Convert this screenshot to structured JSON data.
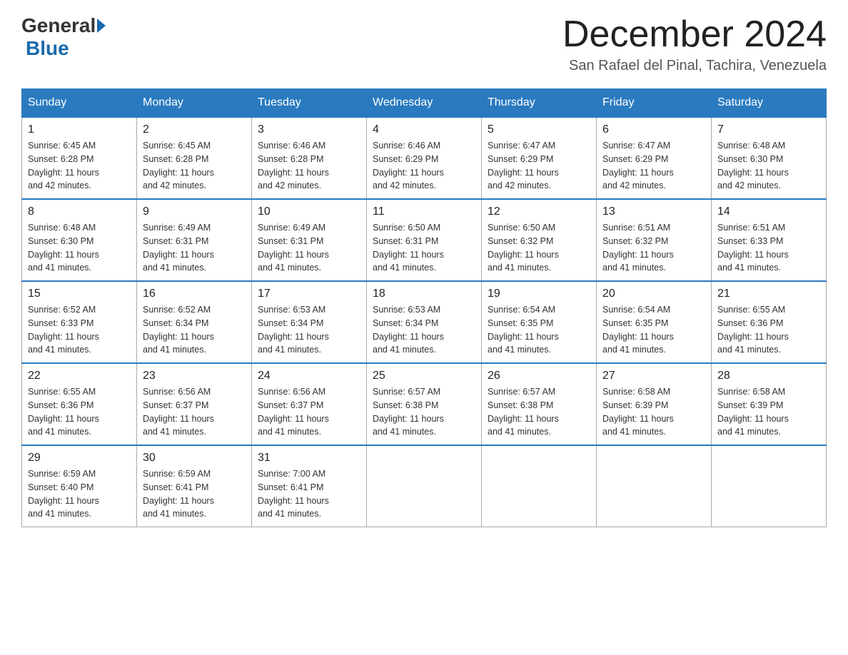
{
  "header": {
    "logo_general": "General",
    "logo_blue": "Blue",
    "month_title": "December 2024",
    "location": "San Rafael del Pinal, Tachira, Venezuela"
  },
  "days_of_week": [
    "Sunday",
    "Monday",
    "Tuesday",
    "Wednesday",
    "Thursday",
    "Friday",
    "Saturday"
  ],
  "weeks": [
    [
      {
        "day": "1",
        "sunrise": "6:45 AM",
        "sunset": "6:28 PM",
        "daylight": "11 hours and 42 minutes."
      },
      {
        "day": "2",
        "sunrise": "6:45 AM",
        "sunset": "6:28 PM",
        "daylight": "11 hours and 42 minutes."
      },
      {
        "day": "3",
        "sunrise": "6:46 AM",
        "sunset": "6:28 PM",
        "daylight": "11 hours and 42 minutes."
      },
      {
        "day": "4",
        "sunrise": "6:46 AM",
        "sunset": "6:29 PM",
        "daylight": "11 hours and 42 minutes."
      },
      {
        "day": "5",
        "sunrise": "6:47 AM",
        "sunset": "6:29 PM",
        "daylight": "11 hours and 42 minutes."
      },
      {
        "day": "6",
        "sunrise": "6:47 AM",
        "sunset": "6:29 PM",
        "daylight": "11 hours and 42 minutes."
      },
      {
        "day": "7",
        "sunrise": "6:48 AM",
        "sunset": "6:30 PM",
        "daylight": "11 hours and 42 minutes."
      }
    ],
    [
      {
        "day": "8",
        "sunrise": "6:48 AM",
        "sunset": "6:30 PM",
        "daylight": "11 hours and 41 minutes."
      },
      {
        "day": "9",
        "sunrise": "6:49 AM",
        "sunset": "6:31 PM",
        "daylight": "11 hours and 41 minutes."
      },
      {
        "day": "10",
        "sunrise": "6:49 AM",
        "sunset": "6:31 PM",
        "daylight": "11 hours and 41 minutes."
      },
      {
        "day": "11",
        "sunrise": "6:50 AM",
        "sunset": "6:31 PM",
        "daylight": "11 hours and 41 minutes."
      },
      {
        "day": "12",
        "sunrise": "6:50 AM",
        "sunset": "6:32 PM",
        "daylight": "11 hours and 41 minutes."
      },
      {
        "day": "13",
        "sunrise": "6:51 AM",
        "sunset": "6:32 PM",
        "daylight": "11 hours and 41 minutes."
      },
      {
        "day": "14",
        "sunrise": "6:51 AM",
        "sunset": "6:33 PM",
        "daylight": "11 hours and 41 minutes."
      }
    ],
    [
      {
        "day": "15",
        "sunrise": "6:52 AM",
        "sunset": "6:33 PM",
        "daylight": "11 hours and 41 minutes."
      },
      {
        "day": "16",
        "sunrise": "6:52 AM",
        "sunset": "6:34 PM",
        "daylight": "11 hours and 41 minutes."
      },
      {
        "day": "17",
        "sunrise": "6:53 AM",
        "sunset": "6:34 PM",
        "daylight": "11 hours and 41 minutes."
      },
      {
        "day": "18",
        "sunrise": "6:53 AM",
        "sunset": "6:34 PM",
        "daylight": "11 hours and 41 minutes."
      },
      {
        "day": "19",
        "sunrise": "6:54 AM",
        "sunset": "6:35 PM",
        "daylight": "11 hours and 41 minutes."
      },
      {
        "day": "20",
        "sunrise": "6:54 AM",
        "sunset": "6:35 PM",
        "daylight": "11 hours and 41 minutes."
      },
      {
        "day": "21",
        "sunrise": "6:55 AM",
        "sunset": "6:36 PM",
        "daylight": "11 hours and 41 minutes."
      }
    ],
    [
      {
        "day": "22",
        "sunrise": "6:55 AM",
        "sunset": "6:36 PM",
        "daylight": "11 hours and 41 minutes."
      },
      {
        "day": "23",
        "sunrise": "6:56 AM",
        "sunset": "6:37 PM",
        "daylight": "11 hours and 41 minutes."
      },
      {
        "day": "24",
        "sunrise": "6:56 AM",
        "sunset": "6:37 PM",
        "daylight": "11 hours and 41 minutes."
      },
      {
        "day": "25",
        "sunrise": "6:57 AM",
        "sunset": "6:38 PM",
        "daylight": "11 hours and 41 minutes."
      },
      {
        "day": "26",
        "sunrise": "6:57 AM",
        "sunset": "6:38 PM",
        "daylight": "11 hours and 41 minutes."
      },
      {
        "day": "27",
        "sunrise": "6:58 AM",
        "sunset": "6:39 PM",
        "daylight": "11 hours and 41 minutes."
      },
      {
        "day": "28",
        "sunrise": "6:58 AM",
        "sunset": "6:39 PM",
        "daylight": "11 hours and 41 minutes."
      }
    ],
    [
      {
        "day": "29",
        "sunrise": "6:59 AM",
        "sunset": "6:40 PM",
        "daylight": "11 hours and 41 minutes."
      },
      {
        "day": "30",
        "sunrise": "6:59 AM",
        "sunset": "6:41 PM",
        "daylight": "11 hours and 41 minutes."
      },
      {
        "day": "31",
        "sunrise": "7:00 AM",
        "sunset": "6:41 PM",
        "daylight": "11 hours and 41 minutes."
      },
      null,
      null,
      null,
      null
    ]
  ],
  "labels": {
    "sunrise": "Sunrise:",
    "sunset": "Sunset:",
    "daylight": "Daylight:"
  }
}
